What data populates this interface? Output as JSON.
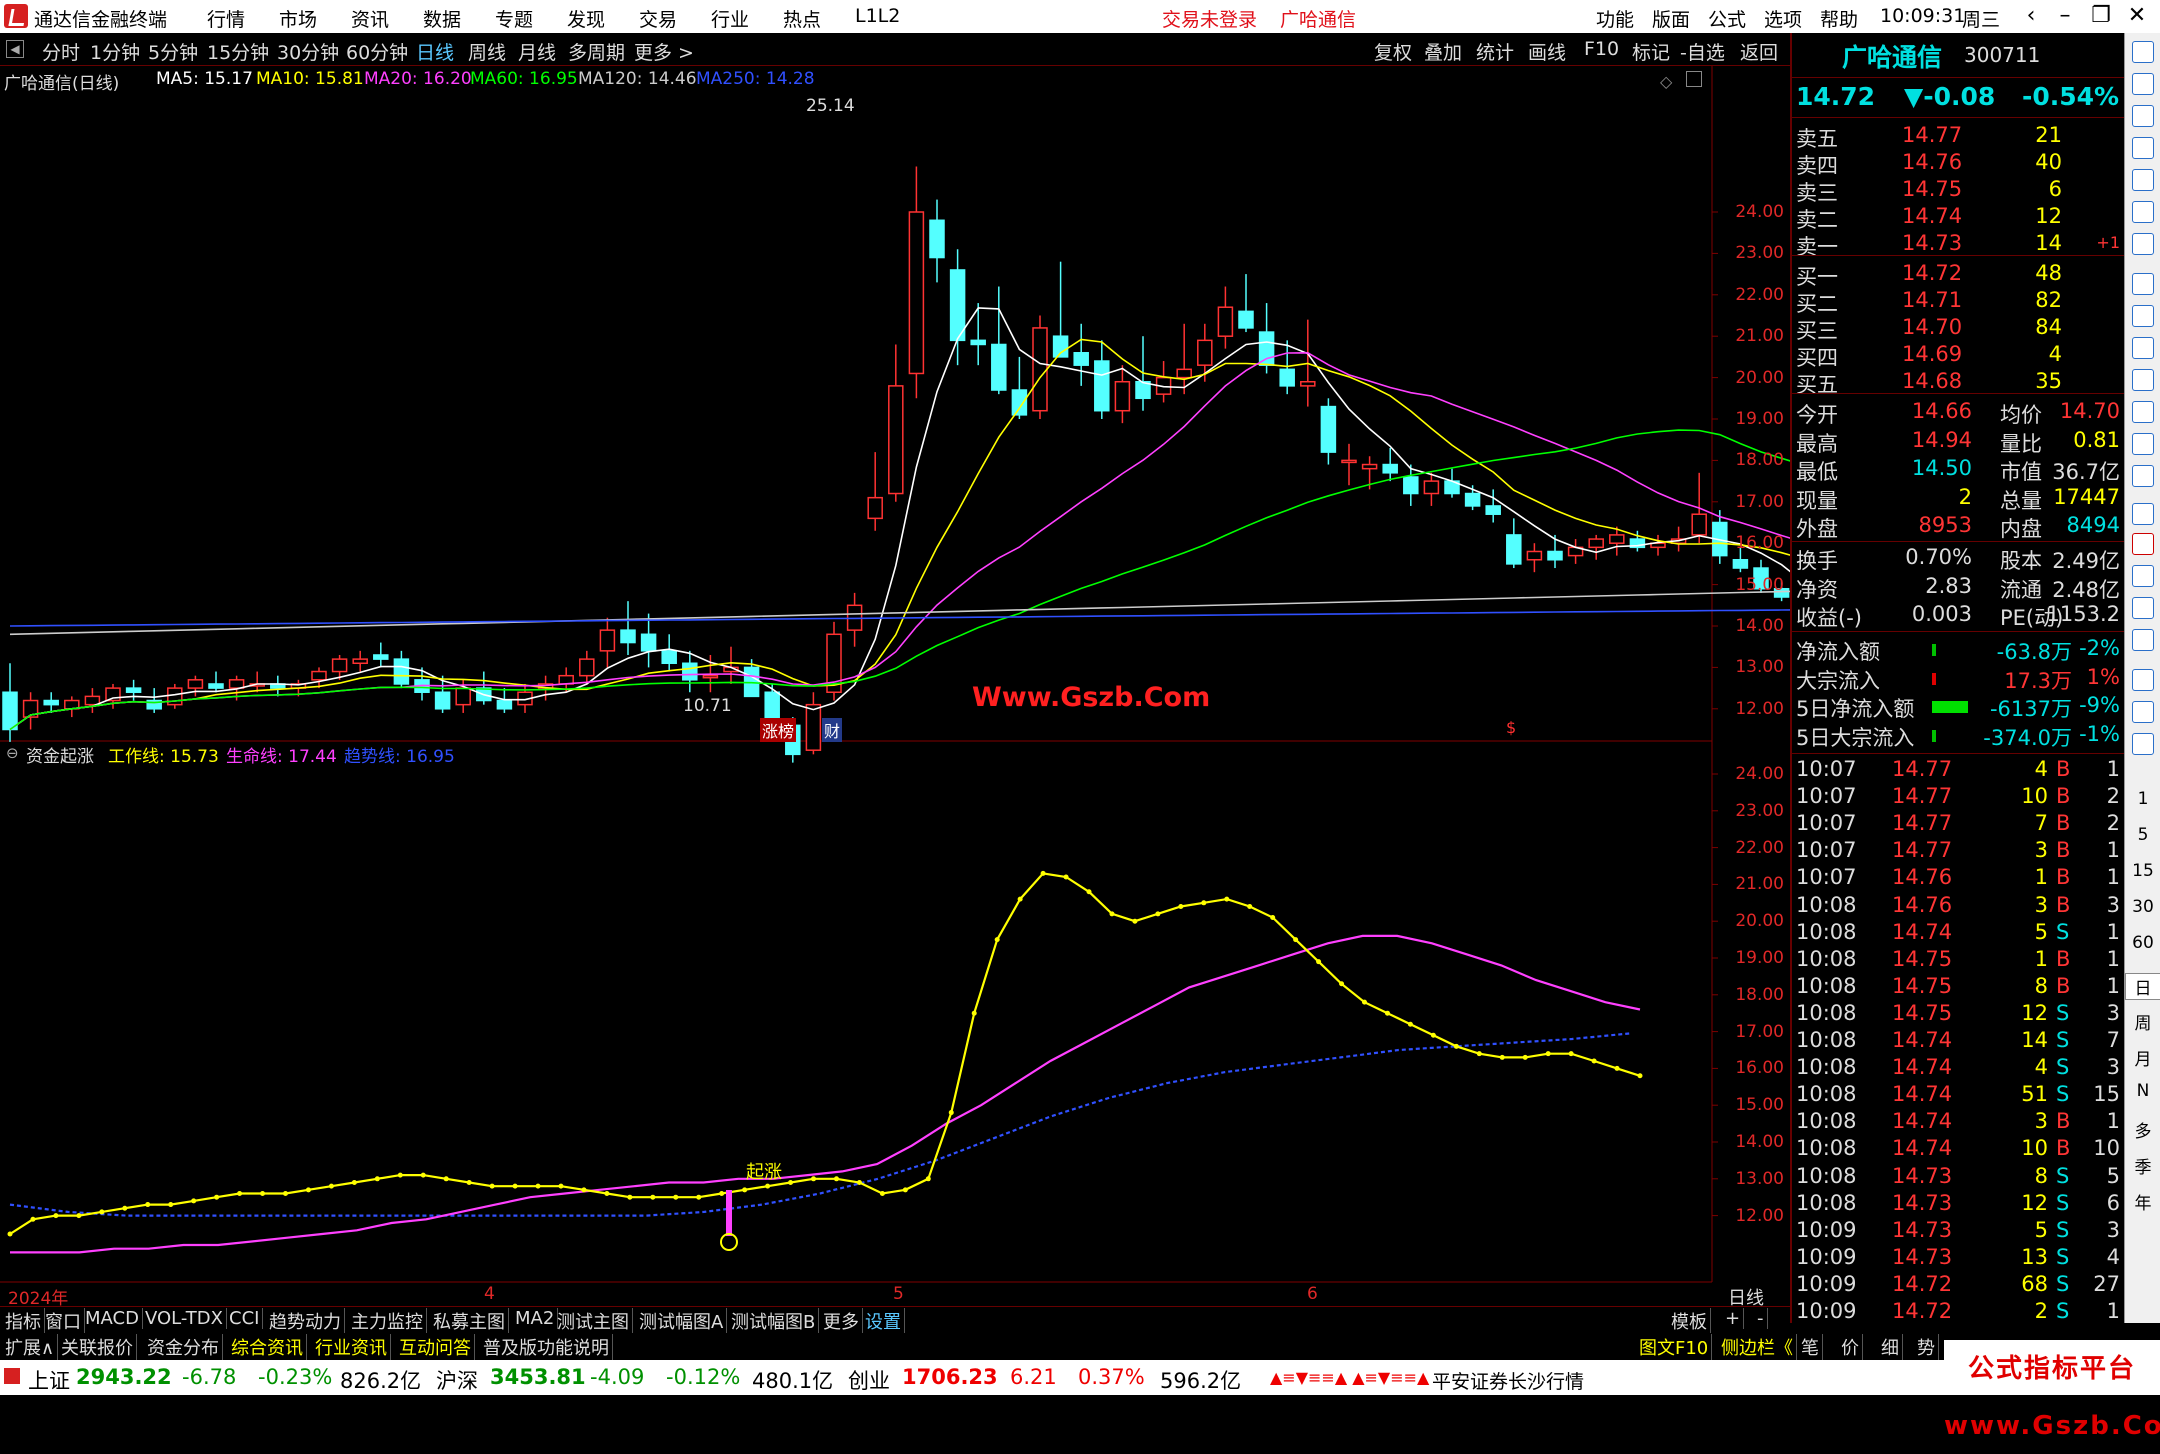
{
  "titlebar": {
    "app_name": "通达信金融终端",
    "menu": [
      "行情",
      "市场",
      "资讯",
      "数据",
      "专题",
      "发现",
      "交易",
      "行业",
      "热点",
      "L1L2"
    ],
    "trade_status": "交易未登录",
    "stock_name": "广哈通信",
    "right_menu": [
      "功能",
      "版面",
      "公式",
      "选项",
      "帮助"
    ],
    "time": "10:09:31",
    "weekday": "周三"
  },
  "periodbar": {
    "periods": [
      "分时",
      "1分钟",
      "5分钟",
      "15分钟",
      "30分钟",
      "60分钟",
      "日线",
      "周线",
      "月线",
      "多周期",
      "更多 >"
    ],
    "active_period": "日线",
    "right_buttons": [
      "复权",
      "叠加",
      "统计",
      "画线",
      "F10",
      "标记",
      "-自选",
      "返回"
    ]
  },
  "main_chart": {
    "title": "广哈通信(日线)",
    "ma_legend": [
      {
        "label": "MA5: 15.17",
        "color": "#ffffff"
      },
      {
        "label": "MA10: 15.81",
        "color": "#ffff00"
      },
      {
        "label": "MA20: 16.20",
        "color": "#ff40ff"
      },
      {
        "label": "MA60: 16.95",
        "color": "#00ff00"
      },
      {
        "label": "MA120: 14.46",
        "color": "#cccccc"
      },
      {
        "label": "MA250: 14.28",
        "color": "#3050ff"
      }
    ],
    "yaxis": [
      "24.00",
      "23.00",
      "22.00",
      "21.00",
      "20.00",
      "19.00",
      "18.00",
      "17.00",
      "16.00",
      "15.00",
      "14.00",
      "13.00",
      "12.00"
    ],
    "high_label": "25.14",
    "low_label": "10.71",
    "watermark": "Www.Gszb.Com",
    "markers": [
      "涨榜",
      "财",
      "$"
    ]
  },
  "sub_chart": {
    "title": "资金起涨",
    "legend": [
      {
        "label": "工作线: 15.73",
        "color": "#ffff00"
      },
      {
        "label": "生命线: 17.44",
        "color": "#ff40ff"
      },
      {
        "label": "趋势线: 16.95",
        "color": "#3050ff"
      }
    ],
    "yaxis": [
      "24.00",
      "23.00",
      "22.00",
      "21.00",
      "20.00",
      "19.00",
      "18.00",
      "17.00",
      "16.00",
      "15.00",
      "14.00",
      "13.00",
      "12.00"
    ],
    "signal_label": "起涨"
  },
  "time_axis": {
    "labels": [
      "2024年",
      "4",
      "5",
      "6"
    ],
    "period_label": "日线"
  },
  "chart_data": {
    "type": "line",
    "title": "广哈通信(日线)",
    "candles": [
      [
        12.4,
        13.1,
        11.2,
        11.5
      ],
      [
        11.8,
        12.4,
        11.5,
        12.2
      ],
      [
        12.2,
        12.4,
        11.9,
        12.1
      ],
      [
        12.0,
        12.3,
        11.8,
        12.2
      ],
      [
        12.1,
        12.5,
        11.9,
        12.3
      ],
      [
        12.2,
        12.6,
        12.0,
        12.5
      ],
      [
        12.5,
        12.7,
        12.2,
        12.4
      ],
      [
        12.2,
        12.5,
        11.9,
        12.0
      ],
      [
        12.1,
        12.6,
        12.0,
        12.5
      ],
      [
        12.5,
        12.8,
        12.3,
        12.7
      ],
      [
        12.6,
        12.9,
        12.4,
        12.5
      ],
      [
        12.5,
        12.8,
        12.2,
        12.7
      ],
      [
        12.6,
        12.9,
        12.4,
        12.6
      ],
      [
        12.6,
        12.8,
        12.3,
        12.5
      ],
      [
        12.5,
        12.7,
        12.3,
        12.6
      ],
      [
        12.7,
        13.0,
        12.5,
        12.9
      ],
      [
        12.9,
        13.3,
        12.7,
        13.2
      ],
      [
        13.1,
        13.4,
        12.9,
        13.2
      ],
      [
        13.3,
        13.6,
        13.0,
        13.2
      ],
      [
        13.2,
        13.4,
        12.5,
        12.6
      ],
      [
        12.7,
        13.0,
        12.2,
        12.4
      ],
      [
        12.4,
        12.8,
        11.9,
        12.0
      ],
      [
        12.1,
        12.7,
        11.9,
        12.5
      ],
      [
        12.5,
        12.9,
        12.1,
        12.2
      ],
      [
        12.2,
        12.5,
        11.9,
        12.0
      ],
      [
        12.1,
        12.6,
        11.9,
        12.4
      ],
      [
        12.5,
        12.8,
        12.2,
        12.6
      ],
      [
        12.6,
        13.0,
        12.4,
        12.8
      ],
      [
        12.8,
        13.4,
        12.6,
        13.2
      ],
      [
        13.4,
        14.2,
        13.0,
        13.9
      ],
      [
        13.9,
        14.6,
        13.3,
        13.6
      ],
      [
        13.8,
        14.3,
        13.0,
        13.4
      ],
      [
        13.4,
        13.8,
        12.9,
        13.1
      ],
      [
        13.1,
        13.4,
        12.4,
        12.7
      ],
      [
        12.8,
        13.3,
        12.4,
        12.8
      ],
      [
        12.9,
        13.5,
        12.6,
        13.0
      ],
      [
        13.0,
        13.2,
        12.4,
        12.3
      ],
      [
        12.4,
        12.6,
        11.7,
        11.6
      ],
      [
        11.6,
        11.8,
        10.7,
        10.9
      ],
      [
        11.0,
        12.4,
        10.9,
        12.1
      ],
      [
        12.4,
        14.1,
        12.2,
        13.8
      ],
      [
        13.9,
        14.8,
        13.5,
        14.5
      ],
      [
        16.6,
        18.2,
        16.3,
        17.1
      ],
      [
        17.2,
        20.8,
        17.0,
        19.8
      ],
      [
        20.1,
        25.1,
        19.5,
        24.0
      ],
      [
        23.8,
        24.3,
        22.3,
        22.9
      ],
      [
        22.6,
        23.1,
        20.3,
        20.9
      ],
      [
        20.9,
        21.8,
        20.3,
        20.8
      ],
      [
        20.8,
        22.2,
        19.6,
        19.7
      ],
      [
        19.7,
        20.5,
        19.0,
        19.1
      ],
      [
        19.2,
        21.5,
        19.0,
        21.2
      ],
      [
        21.0,
        22.8,
        20.5,
        20.5
      ],
      [
        20.6,
        21.3,
        19.8,
        20.3
      ],
      [
        20.4,
        20.9,
        19.0,
        19.2
      ],
      [
        19.2,
        20.3,
        18.9,
        19.9
      ],
      [
        19.9,
        21.0,
        19.2,
        19.5
      ],
      [
        19.6,
        20.4,
        19.4,
        20.0
      ],
      [
        20.0,
        21.3,
        19.6,
        20.2
      ],
      [
        20.3,
        21.3,
        19.9,
        20.9
      ],
      [
        21.0,
        22.2,
        20.7,
        21.7
      ],
      [
        21.6,
        22.5,
        21.1,
        21.2
      ],
      [
        21.1,
        21.8,
        20.1,
        20.3
      ],
      [
        20.2,
        20.9,
        19.6,
        19.8
      ],
      [
        19.8,
        21.4,
        19.3,
        19.9
      ],
      [
        19.3,
        19.5,
        17.9,
        18.2
      ],
      [
        18.0,
        18.4,
        17.4,
        18.0
      ],
      [
        17.8,
        18.1,
        17.3,
        17.9
      ],
      [
        17.9,
        18.3,
        17.5,
        17.7
      ],
      [
        17.6,
        17.9,
        16.9,
        17.2
      ],
      [
        17.2,
        17.7,
        16.9,
        17.5
      ],
      [
        17.5,
        17.8,
        17.1,
        17.2
      ],
      [
        17.2,
        17.4,
        16.8,
        16.9
      ],
      [
        16.9,
        17.3,
        16.5,
        16.7
      ],
      [
        16.2,
        16.6,
        15.4,
        15.5
      ],
      [
        15.6,
        16.0,
        15.3,
        15.8
      ],
      [
        15.8,
        16.2,
        15.4,
        15.6
      ],
      [
        15.7,
        16.1,
        15.5,
        15.9
      ],
      [
        15.9,
        16.2,
        15.6,
        16.1
      ],
      [
        16.0,
        16.4,
        15.7,
        16.2
      ],
      [
        16.1,
        16.3,
        15.8,
        15.9
      ],
      [
        15.9,
        16.2,
        15.7,
        16.0
      ],
      [
        16.0,
        16.4,
        15.8,
        16.1
      ],
      [
        16.2,
        17.7,
        16.0,
        16.7
      ],
      [
        16.5,
        16.8,
        15.5,
        15.7
      ],
      [
        15.6,
        15.9,
        15.3,
        15.4
      ],
      [
        15.4,
        15.6,
        14.8,
        14.9
      ],
      [
        14.9,
        15.1,
        14.6,
        14.7
      ],
      [
        14.66,
        14.94,
        14.5,
        14.72
      ]
    ],
    "series": [
      {
        "name": "工作线",
        "values": [
          11.5,
          11.9,
          12.0,
          12.0,
          12.1,
          12.2,
          12.3,
          12.3,
          12.4,
          12.5,
          12.6,
          12.6,
          12.6,
          12.7,
          12.8,
          12.9,
          13.0,
          13.1,
          13.1,
          13.0,
          12.9,
          12.8,
          12.8,
          12.8,
          12.8,
          12.7,
          12.6,
          12.5,
          12.5,
          12.5,
          12.5,
          12.6,
          12.7,
          12.8,
          12.9,
          13.0,
          13.0,
          12.9,
          12.6,
          12.7,
          13.0,
          14.8,
          17.5,
          19.5,
          20.6,
          21.3,
          21.2,
          20.8,
          20.2,
          20.0,
          20.2,
          20.4,
          20.5,
          20.6,
          20.4,
          20.1,
          19.5,
          18.9,
          18.3,
          17.8,
          17.5,
          17.2,
          16.9,
          16.6,
          16.4,
          16.3,
          16.3,
          16.4,
          16.4,
          16.2,
          16.0,
          15.8
        ]
      },
      {
        "name": "生命线",
        "values": [
          11.0,
          11.0,
          11.0,
          11.1,
          11.1,
          11.2,
          11.2,
          11.3,
          11.4,
          11.5,
          11.6,
          11.8,
          11.9,
          12.1,
          12.3,
          12.5,
          12.6,
          12.7,
          12.8,
          12.9,
          12.9,
          13.0,
          13.0,
          13.1,
          13.2,
          13.4,
          13.9,
          14.5,
          15.0,
          15.6,
          16.2,
          16.7,
          17.2,
          17.7,
          18.2,
          18.5,
          18.8,
          19.1,
          19.4,
          19.6,
          19.6,
          19.4,
          19.1,
          18.8,
          18.4,
          18.1,
          17.8,
          17.6
        ]
      },
      {
        "name": "趋势线",
        "values": [
          12.3,
          12.1,
          12.0,
          12.0,
          12.0,
          12.0,
          12.0,
          12.0,
          12.0,
          12.0,
          12.0,
          12.0,
          12.1,
          12.3,
          12.6,
          13.0,
          13.5,
          14.1,
          14.7,
          15.2,
          15.6,
          15.9,
          16.1,
          16.3,
          16.5,
          16.6,
          16.7,
          16.8,
          16.95
        ]
      }
    ],
    "ylim": [
      10.5,
      25.5
    ]
  },
  "quote": {
    "name": "广哈通信",
    "code": "300711",
    "price": "14.72",
    "change": "▼-0.08",
    "pct": "-0.54%",
    "asks": [
      {
        "label": "卖五",
        "price": "14.77",
        "vol": "21"
      },
      {
        "label": "卖四",
        "price": "14.76",
        "vol": "40"
      },
      {
        "label": "卖三",
        "price": "14.75",
        "vol": "6"
      },
      {
        "label": "卖二",
        "price": "14.74",
        "vol": "12"
      },
      {
        "label": "卖一",
        "price": "14.73",
        "vol": "14",
        "delta": "+1"
      }
    ],
    "bids": [
      {
        "label": "买一",
        "price": "14.72",
        "vol": "48"
      },
      {
        "label": "买二",
        "price": "14.71",
        "vol": "82"
      },
      {
        "label": "买三",
        "price": "14.70",
        "vol": "84"
      },
      {
        "label": "买四",
        "price": "14.69",
        "vol": "4"
      },
      {
        "label": "买五",
        "price": "14.68",
        "vol": "35"
      }
    ],
    "stats": [
      {
        "l1": "今开",
        "v1": "14.66",
        "c1": "red",
        "l2": "均价",
        "v2": "14.70",
        "c2": "red"
      },
      {
        "l1": "最高",
        "v1": "14.94",
        "c1": "red",
        "l2": "量比",
        "v2": "0.81",
        "c2": "yel"
      },
      {
        "l1": "最低",
        "v1": "14.50",
        "c1": "grn",
        "l2": "市值",
        "v2": "36.7亿",
        "c2": "wht"
      },
      {
        "l1": "现量",
        "v1": "2",
        "c1": "yel",
        "l2": "总量",
        "v2": "17447",
        "c2": "yel"
      },
      {
        "l1": "外盘",
        "v1": "8953",
        "c1": "red",
        "l2": "内盘",
        "v2": "8494",
        "c2": "grn"
      }
    ],
    "finance": [
      {
        "l1": "换手",
        "v1": "0.70%",
        "l2": "股本",
        "v2": "2.49亿"
      },
      {
        "l1": "净资",
        "v1": "2.83",
        "l2": "流通",
        "v2": "2.48亿"
      },
      {
        "l1": "收益(-)",
        "v1": "0.003",
        "l2": "PE(动)",
        "v2": "1153.2"
      }
    ],
    "flows": [
      {
        "label": "净流入额",
        "value": "-63.8万",
        "pct": "-2%",
        "c": "grn"
      },
      {
        "label": "大宗流入",
        "value": "17.3万",
        "pct": "1%",
        "c": "red"
      },
      {
        "label": "5日净流入额",
        "value": "-6137万",
        "pct": "-9%",
        "c": "grn"
      },
      {
        "label": "5日大宗流入",
        "value": "-374.0万",
        "pct": "-1%",
        "c": "grn"
      }
    ],
    "ticks": [
      {
        "t": "10:07",
        "p": "14.77",
        "v": "4",
        "d": "B",
        "n": "1"
      },
      {
        "t": "10:07",
        "p": "14.77",
        "v": "10",
        "d": "B",
        "n": "2"
      },
      {
        "t": "10:07",
        "p": "14.77",
        "v": "7",
        "d": "B",
        "n": "2"
      },
      {
        "t": "10:07",
        "p": "14.77",
        "v": "3",
        "d": "B",
        "n": "1"
      },
      {
        "t": "10:07",
        "p": "14.76",
        "v": "1",
        "d": "B",
        "n": "1"
      },
      {
        "t": "10:08",
        "p": "14.76",
        "v": "3",
        "d": "B",
        "n": "3"
      },
      {
        "t": "10:08",
        "p": "14.74",
        "v": "5",
        "d": "S",
        "n": "1"
      },
      {
        "t": "10:08",
        "p": "14.75",
        "v": "1",
        "d": "B",
        "n": "1"
      },
      {
        "t": "10:08",
        "p": "14.75",
        "v": "8",
        "d": "B",
        "n": "1"
      },
      {
        "t": "10:08",
        "p": "14.75",
        "v": "12",
        "d": "S",
        "n": "3"
      },
      {
        "t": "10:08",
        "p": "14.74",
        "v": "14",
        "d": "S",
        "n": "7"
      },
      {
        "t": "10:08",
        "p": "14.74",
        "v": "4",
        "d": "S",
        "n": "3"
      },
      {
        "t": "10:08",
        "p": "14.74",
        "v": "51",
        "d": "S",
        "n": "15"
      },
      {
        "t": "10:08",
        "p": "14.74",
        "v": "3",
        "d": "B",
        "n": "1"
      },
      {
        "t": "10:08",
        "p": "14.74",
        "v": "10",
        "d": "B",
        "n": "10"
      },
      {
        "t": "10:08",
        "p": "14.73",
        "v": "8",
        "d": "S",
        "n": "5"
      },
      {
        "t": "10:08",
        "p": "14.73",
        "v": "12",
        "d": "S",
        "n": "6"
      },
      {
        "t": "10:09",
        "p": "14.73",
        "v": "5",
        "d": "S",
        "n": "3"
      },
      {
        "t": "10:09",
        "p": "14.73",
        "v": "13",
        "d": "S",
        "n": "4"
      },
      {
        "t": "10:09",
        "p": "14.72",
        "v": "68",
        "d": "S",
        "n": "27"
      },
      {
        "t": "10:09",
        "p": "14.72",
        "v": "2",
        "d": "S",
        "n": "1"
      }
    ]
  },
  "sidebar": {
    "labels": [
      "1",
      "5",
      "15",
      "30",
      "60",
      "日",
      "周",
      "月",
      "N",
      "多",
      "季",
      "年"
    ]
  },
  "tabs1": [
    "指标",
    "窗口",
    "MACD",
    "VOL-TDX",
    "CCI",
    "趋势动力",
    "主力监控",
    "私募主图",
    "MA2",
    "测试主图",
    "测试幅图A",
    "测试幅图B",
    "更多",
    "设置"
  ],
  "tabs1_right": [
    "模板",
    "+",
    "-"
  ],
  "tabs2": [
    "扩展∧",
    "关联报价",
    "资金分布",
    "综合资讯",
    "行业资讯",
    "互动问答",
    "普及版功能说明"
  ],
  "tabs2_right": [
    "图文F10",
    "侧边栏《",
    "笔",
    "价",
    "细",
    "势"
  ],
  "statusbar": {
    "idx1_name": "上证",
    "idx1_val": "2943.22",
    "idx1_chg": "-6.78",
    "idx1_pct": "-0.23%",
    "idx1_amt": "826.2亿",
    "idx2_name": "沪深",
    "idx2_val": "3453.81",
    "idx2_chg": "-4.09",
    "idx2_pct": "-0.12%",
    "idx2_amt": "480.1亿",
    "idx3_name": "创业",
    "idx3_val": "1706.23",
    "idx3_chg": "6.21",
    "idx3_pct": "0.37%",
    "idx3_amt": "596.2亿",
    "broker": "平安证券长沙行情"
  },
  "brand": "公式指标平台 www.Gszb.Com"
}
